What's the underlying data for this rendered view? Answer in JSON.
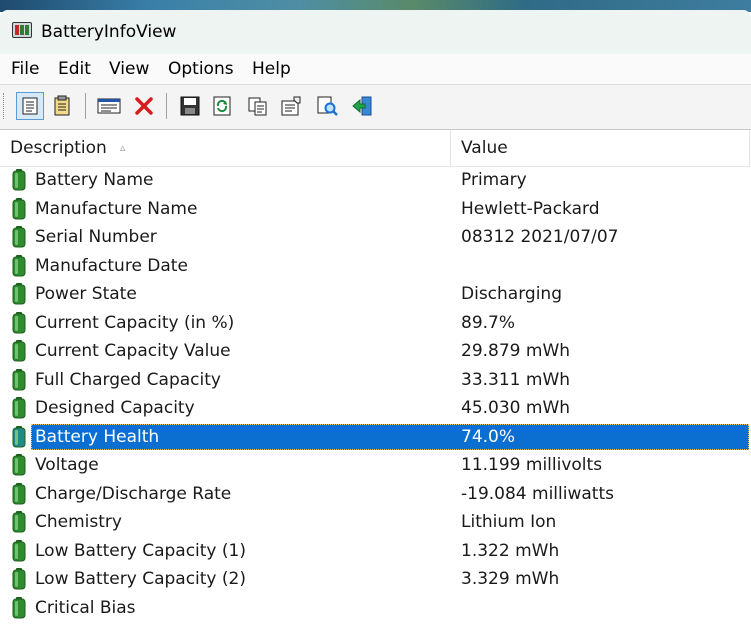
{
  "window": {
    "title": "BatteryInfoView"
  },
  "menu": [
    "File",
    "Edit",
    "View",
    "Options",
    "Help"
  ],
  "toolbar": {
    "buttons": [
      "properties-view-icon",
      "details-view-icon",
      "html-report-icon",
      "delete-icon",
      "save-icon",
      "refresh-icon",
      "copy-icon",
      "properties-icon",
      "find-icon",
      "exit-icon"
    ]
  },
  "columns": {
    "description": "Description",
    "value": "Value"
  },
  "rows": [
    {
      "label": "Battery Name",
      "value": "Primary"
    },
    {
      "label": "Manufacture Name",
      "value": "Hewlett-Packard"
    },
    {
      "label": "Serial Number",
      "value": "08312 2021/07/07"
    },
    {
      "label": "Manufacture Date",
      "value": ""
    },
    {
      "label": "Power State",
      "value": "Discharging"
    },
    {
      "label": "Current Capacity (in %)",
      "value": "89.7%"
    },
    {
      "label": "Current Capacity Value",
      "value": "29.879 mWh"
    },
    {
      "label": "Full Charged Capacity",
      "value": "33.311 mWh"
    },
    {
      "label": "Designed Capacity",
      "value": "45.030 mWh"
    },
    {
      "label": "Battery Health",
      "value": "74.0%"
    },
    {
      "label": "Voltage",
      "value": "11.199 millivolts"
    },
    {
      "label": "Charge/Discharge Rate",
      "value": "-19.084 milliwatts"
    },
    {
      "label": "Chemistry",
      "value": "Lithium Ion"
    },
    {
      "label": "Low Battery Capacity (1)",
      "value": "1.322 mWh"
    },
    {
      "label": "Low Battery Capacity (2)",
      "value": "3.329 mWh"
    },
    {
      "label": "Critical Bias",
      "value": ""
    }
  ],
  "selected_row": "Battery Health",
  "colors": {
    "selection": "#0a6fd1",
    "battery_icon": "#2e8b2e"
  }
}
